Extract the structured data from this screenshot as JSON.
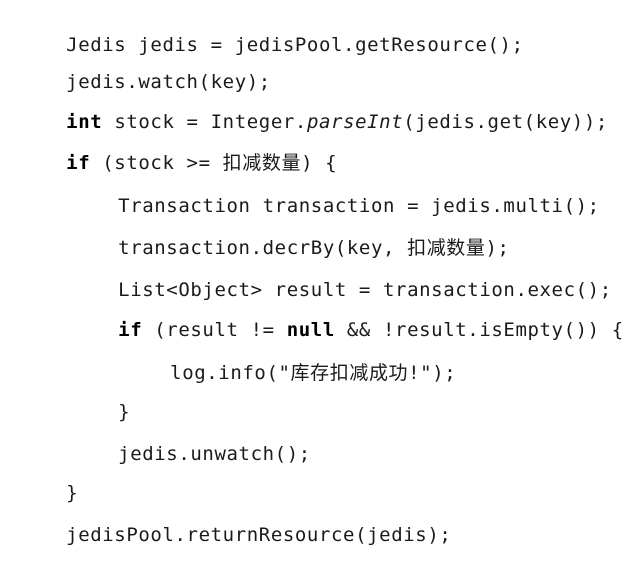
{
  "code": {
    "l1": {
      "text": "Jedis jedis = jedisPool.getResource();"
    },
    "l2": {
      "text": "jedis.watch(key);"
    },
    "l3": {
      "kw": "int",
      "a": " stock = Integer.",
      "it": "parseInt",
      "b": "(jedis.get(key));"
    },
    "l4": {
      "kw": "if",
      "a": " (stock >= 扣减数量) {"
    },
    "l5": {
      "text": "Transaction transaction = jedis.multi();"
    },
    "l6": {
      "text": "transaction.decrBy(key, 扣减数量);"
    },
    "l7": {
      "text": "List<Object> result = transaction.exec();"
    },
    "l8": {
      "kw": "if",
      "a": " (result != ",
      "kw2": "null",
      "b": " && !result.isEmpty()) {"
    },
    "l9": {
      "text": "log.info(\"库存扣减成功!\");"
    },
    "l10": {
      "text": "}"
    },
    "l11": {
      "text": "jedis.unwatch();"
    },
    "l12": {
      "text": "}"
    },
    "l13": {
      "text": "jedisPool.returnResource(jedis);"
    }
  }
}
